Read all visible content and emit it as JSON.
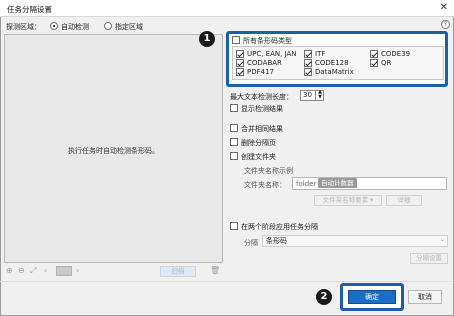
{
  "window": {
    "title": "任务分隔设置"
  },
  "detect": {
    "label": "探测区域：",
    "options": [
      {
        "label": "自动检测",
        "selected": true
      },
      {
        "label": "指定区域",
        "selected": false
      }
    ]
  },
  "preview": {
    "message": "执行任务时自动检测条形码。",
    "scan_label": "扫描"
  },
  "barcodes": {
    "all_label": "所有条形码类型",
    "all_checked": false,
    "types": [
      {
        "label": "UPC, EAN, JAN",
        "checked": true
      },
      {
        "label": "ITF",
        "checked": true
      },
      {
        "label": "CODE39",
        "checked": true
      },
      {
        "label": "CODABAR",
        "checked": true
      },
      {
        "label": "CODE128",
        "checked": true
      },
      {
        "label": "QR",
        "checked": true
      },
      {
        "label": "PDF417",
        "checked": true
      },
      {
        "label": "DataMatrix",
        "checked": true
      }
    ]
  },
  "options": {
    "max_length_label": "最大文本检测长度：",
    "max_length_value": "30",
    "show_result_label": "显示检测结果",
    "merge_label": "合并相同结果",
    "delete_sep_label": "删除分隔页",
    "create_folder_label": "创建文件夹",
    "folder_name_example_label": "文件夹名称示例",
    "folder_name_label": "文件夹名称：",
    "folder_name_prefix": "folder",
    "folder_name_chip": "自动计数器",
    "folder_name_elements_label": "文件夹名称要素 ▾",
    "details_label": "详细",
    "two_stage_label": "在两个阶段应用任务分隔",
    "separation_label": "分隔",
    "separation_value": "条形码",
    "separation_settings_label": "分隔设置"
  },
  "callouts": {
    "first": "1",
    "second": "2"
  },
  "footer": {
    "ok_label": "确定",
    "cancel_label": "取消"
  },
  "colors": {
    "accent": "#1a5fa8",
    "ok_button": "#1a6fc4"
  }
}
